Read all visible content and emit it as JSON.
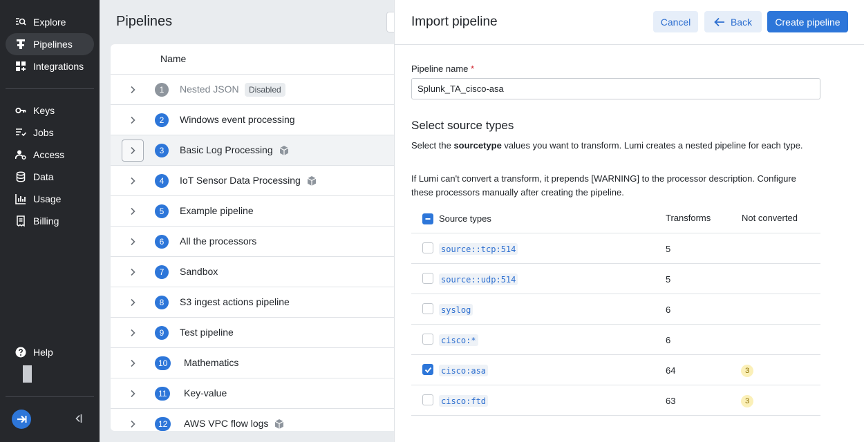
{
  "sidebar": {
    "items": [
      {
        "label": "Explore",
        "icon": "explore-icon"
      },
      {
        "label": "Pipelines",
        "icon": "pipelines-icon"
      },
      {
        "label": "Integrations",
        "icon": "integrations-icon"
      },
      {
        "label": "Keys",
        "icon": "key-icon"
      },
      {
        "label": "Jobs",
        "icon": "jobs-icon"
      },
      {
        "label": "Access",
        "icon": "access-icon"
      },
      {
        "label": "Data",
        "icon": "database-icon"
      },
      {
        "label": "Usage",
        "icon": "usage-chart-icon"
      },
      {
        "label": "Billing",
        "icon": "billing-icon"
      }
    ],
    "help_label": "Help",
    "active": "Pipelines"
  },
  "main": {
    "title": "Pipelines",
    "column_name": "Name",
    "pipelines": [
      {
        "num": "1",
        "name": "Nested JSON",
        "disabled": true,
        "badge": "Disabled",
        "packaged": false
      },
      {
        "num": "2",
        "name": "Windows event processing",
        "disabled": false,
        "packaged": false
      },
      {
        "num": "3",
        "name": "Basic Log Processing",
        "disabled": false,
        "packaged": true
      },
      {
        "num": "4",
        "name": "IoT Sensor Data Processing",
        "disabled": false,
        "packaged": true
      },
      {
        "num": "5",
        "name": "Example pipeline",
        "disabled": false,
        "packaged": false
      },
      {
        "num": "6",
        "name": "All the processors",
        "disabled": false,
        "packaged": false
      },
      {
        "num": "7",
        "name": "Sandbox",
        "disabled": false,
        "packaged": false
      },
      {
        "num": "8",
        "name": "S3 ingest actions pipeline",
        "disabled": false,
        "packaged": false
      },
      {
        "num": "9",
        "name": "Test pipeline",
        "disabled": false,
        "packaged": false
      },
      {
        "num": "10",
        "name": "Mathematics",
        "disabled": false,
        "packaged": false
      },
      {
        "num": "11",
        "name": "Key-value",
        "disabled": false,
        "packaged": false
      },
      {
        "num": "12",
        "name": "AWS VPC flow logs",
        "disabled": false,
        "packaged": true
      }
    ]
  },
  "panel": {
    "title": "Import pipeline",
    "cancel_label": "Cancel",
    "back_label": "Back",
    "create_label": "Create pipeline",
    "name_label": "Pipeline name",
    "required_mark": "*",
    "name_value": "Splunk_TA_cisco-asa",
    "section_title": "Select source types",
    "desc1_pre": "Select the ",
    "desc1_bold": "sourcetype",
    "desc1_post": " values you want to transform. Lumi creates a nested pipeline for each type.",
    "desc2": "If Lumi can't convert a transform, it prepends [WARNING] to the processor description. Configure these processors manually after creating the pipeline.",
    "col_source": "Source types",
    "col_transforms": "Transforms",
    "col_not_converted": "Not converted",
    "source_types": [
      {
        "name": "source::tcp:514",
        "transforms": "5",
        "not_converted": "",
        "checked": false
      },
      {
        "name": "source::udp:514",
        "transforms": "5",
        "not_converted": "",
        "checked": false
      },
      {
        "name": "syslog",
        "transforms": "6",
        "not_converted": "",
        "checked": false
      },
      {
        "name": "cisco:*",
        "transforms": "6",
        "not_converted": "",
        "checked": false
      },
      {
        "name": "cisco:asa",
        "transforms": "64",
        "not_converted": "3",
        "checked": true
      },
      {
        "name": "cisco:ftd",
        "transforms": "63",
        "not_converted": "3",
        "checked": false
      }
    ]
  },
  "colors": {
    "accent": "#2d76d9",
    "sidebar_bg": "#26282c",
    "warning_badge": "#fbf0b8"
  }
}
